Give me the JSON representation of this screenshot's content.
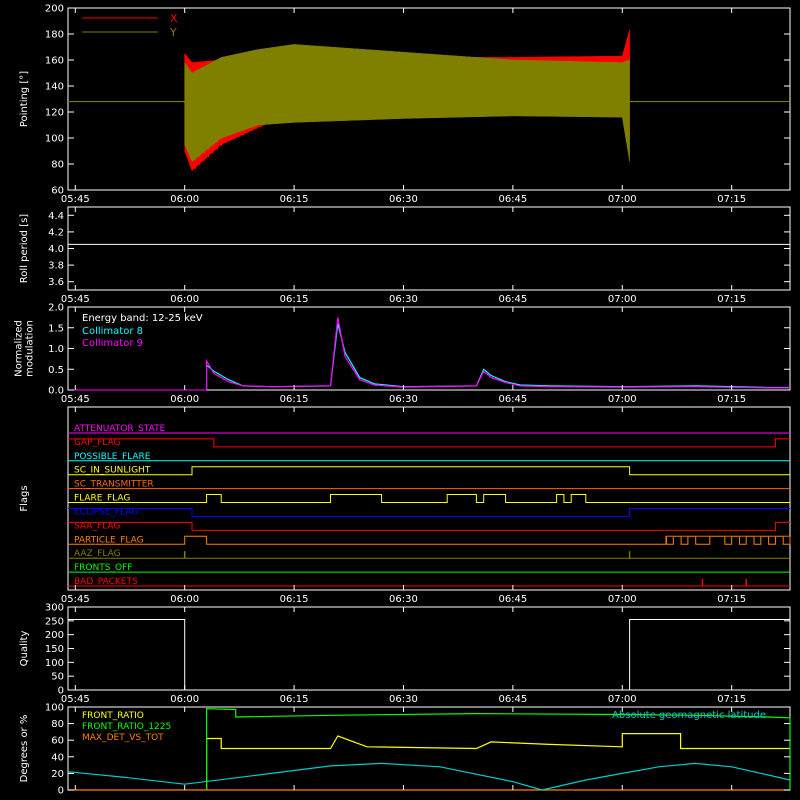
{
  "chart_data": [
    {
      "type": "line",
      "panel": "pointing",
      "ylabel": "Pointing [°]",
      "ylim": [
        60,
        200
      ],
      "yticks": [
        "60",
        "80",
        "100",
        "120",
        "140",
        "160",
        "180",
        "200"
      ],
      "xticks": [
        "05:45",
        "06:00",
        "06:15",
        "06:30",
        "06:45",
        "07:00",
        "07:15"
      ],
      "series": [
        {
          "name": "X",
          "color": "#ff0000",
          "x": [
            "05:44",
            "06:00",
            "06:00",
            "06:01",
            "06:05",
            "06:10",
            "06:15",
            "06:20",
            "06:30",
            "06:45",
            "07:00",
            "07:01",
            "07:01",
            "07:23"
          ],
          "upper": [
            128,
            128,
            165,
            158,
            160,
            162,
            164,
            163,
            162,
            162,
            163,
            183,
            128,
            128
          ],
          "lower": [
            128,
            128,
            90,
            75,
            95,
            108,
            120,
            122,
            123,
            123,
            122,
            100,
            128,
            128
          ]
        },
        {
          "name": "Y",
          "color": "#808000",
          "x": [
            "05:44",
            "06:00",
            "06:00",
            "06:01",
            "06:05",
            "06:10",
            "06:15",
            "06:20",
            "06:30",
            "06:45",
            "07:00",
            "07:01",
            "07:01",
            "07:23"
          ],
          "upper": [
            128,
            128,
            158,
            150,
            162,
            168,
            172,
            170,
            166,
            160,
            158,
            160,
            128,
            128
          ],
          "lower": [
            128,
            128,
            95,
            82,
            100,
            110,
            112,
            113,
            115,
            117,
            116,
            82,
            128,
            128
          ]
        }
      ]
    },
    {
      "type": "line",
      "panel": "roll",
      "ylabel": "Roll period [s]",
      "ylim": [
        3.5,
        4.5
      ],
      "yticks": [
        "3.6",
        "3.8",
        "4.0",
        "4.2",
        "4.4"
      ],
      "xticks": [
        "05:45",
        "06:00",
        "06:15",
        "06:30",
        "06:45",
        "07:00",
        "07:15"
      ],
      "series": [
        {
          "name": "",
          "color": "#ffffff",
          "x": [
            "05:44",
            "07:23"
          ],
          "values": [
            4.05,
            4.05
          ]
        }
      ]
    },
    {
      "type": "line",
      "panel": "modulation",
      "ylabel": [
        "Normalized",
        "modulation"
      ],
      "ylim": [
        0,
        2.0
      ],
      "yticks": [
        "0.0",
        "0.5",
        "1.0",
        "1.5",
        "2.0"
      ],
      "xticks": [
        "05:45",
        "06:00",
        "06:15",
        "06:30",
        "06:45",
        "07:00",
        "07:15"
      ],
      "annotation": "Energy band: 12-25 keV",
      "series": [
        {
          "name": "Collimator 8",
          "color": "#00ffff",
          "x": [
            "06:03",
            "06:03",
            "06:04",
            "06:06",
            "06:08",
            "06:12",
            "06:20",
            "06:21",
            "06:22",
            "06:24",
            "06:26",
            "06:30",
            "06:40",
            "06:41",
            "06:42",
            "06:44",
            "06:46",
            "06:50",
            "07:00",
            "07:10",
            "07:20",
            "07:23"
          ],
          "values": [
            0.0,
            0.6,
            0.45,
            0.25,
            0.1,
            0.08,
            0.1,
            1.6,
            0.9,
            0.3,
            0.15,
            0.08,
            0.1,
            0.5,
            0.35,
            0.2,
            0.12,
            0.1,
            0.08,
            0.1,
            0.06,
            0.06
          ]
        },
        {
          "name": "Collimator 9",
          "color": "#ff00ff",
          "x": [
            "06:03",
            "06:03",
            "06:04",
            "06:06",
            "06:08",
            "06:12",
            "06:20",
            "06:21",
            "06:22",
            "06:24",
            "06:26",
            "06:30",
            "06:40",
            "06:41",
            "06:42",
            "06:44",
            "06:46",
            "06:50",
            "07:00",
            "07:10",
            "07:20",
            "07:23"
          ],
          "values": [
            0.0,
            0.7,
            0.4,
            0.2,
            0.1,
            0.08,
            0.1,
            1.75,
            0.8,
            0.25,
            0.12,
            0.07,
            0.1,
            0.45,
            0.3,
            0.18,
            0.1,
            0.08,
            0.07,
            0.08,
            0.05,
            0.05
          ]
        }
      ]
    },
    {
      "type": "step",
      "panel": "flags",
      "ylabel": "Flags",
      "xticks": [
        "05:45",
        "06:00",
        "06:15",
        "06:30",
        "06:45",
        "07:00",
        "07:15"
      ],
      "flags": [
        {
          "name": "ATTENUATOR_STATE",
          "color": "#ff00ff",
          "x": [
            "05:44",
            "07:23"
          ],
          "v": [
            0,
            0
          ]
        },
        {
          "name": "GAP_FLAG",
          "color": "#ff0000",
          "x": [
            "05:44",
            "06:04",
            "06:04",
            "07:21",
            "07:21",
            "07:23"
          ],
          "v": [
            1,
            1,
            0,
            0,
            1,
            1
          ]
        },
        {
          "name": "POSSIBLE_FLARE",
          "color": "#00ffff",
          "x": [
            "05:44",
            "07:23"
          ],
          "v": [
            0,
            0
          ]
        },
        {
          "name": "SC_IN_SUNLIGHT",
          "color": "#ffff00",
          "x": [
            "05:44",
            "06:01",
            "06:01",
            "07:01",
            "07:01",
            "07:23"
          ],
          "v": [
            0,
            0,
            1,
            1,
            0,
            0
          ]
        },
        {
          "name": "SC_TRANSMITTER",
          "color": "#ff6600",
          "x": [
            "05:44",
            "07:23"
          ],
          "v": [
            0,
            0
          ]
        },
        {
          "name": "FLARE_FLAG",
          "color": "#ffff00",
          "x": [
            "05:44",
            "06:03",
            "06:03",
            "06:05",
            "06:05",
            "06:20",
            "06:20",
            "06:27",
            "06:27",
            "06:36",
            "06:36",
            "06:40",
            "06:40",
            "06:41",
            "06:41",
            "06:44",
            "06:44",
            "06:51",
            "06:51",
            "06:52",
            "06:52",
            "06:53",
            "06:53",
            "06:55",
            "06:55",
            "07:23"
          ],
          "v": [
            0,
            0,
            1,
            1,
            0,
            0,
            1,
            1,
            0,
            0,
            1,
            1,
            0,
            0,
            1,
            1,
            0,
            0,
            1,
            1,
            0,
            0,
            1,
            1,
            0,
            0
          ]
        },
        {
          "name": "ECLIPSE_FLAG",
          "color": "#0000ff",
          "x": [
            "05:44",
            "06:01",
            "06:01",
            "07:01",
            "07:01",
            "07:23"
          ],
          "v": [
            1,
            1,
            0,
            0,
            1,
            1
          ]
        },
        {
          "name": "SAA_FLAG",
          "color": "#ff0000",
          "x": [
            "05:44",
            "06:01",
            "06:01",
            "07:21",
            "07:21",
            "07:23"
          ],
          "v": [
            1,
            1,
            0,
            0,
            1,
            1
          ]
        },
        {
          "name": "PARTICLE_FLAG",
          "color": "#ff8000",
          "x": [
            "05:44",
            "06:00",
            "06:00",
            "06:03",
            "06:03",
            "07:06",
            "07:06",
            "07:23"
          ],
          "v": [
            0,
            0,
            1,
            1,
            0,
            0,
            1,
            1
          ],
          "drops": [
            [
              "07:06",
              "07:07"
            ],
            [
              "07:08",
              "07:09"
            ],
            [
              "07:10",
              "07:12"
            ],
            [
              "07:14",
              "07:15"
            ],
            [
              "07:16",
              "07:17"
            ],
            [
              "07:18",
              "07:19"
            ],
            [
              "07:20",
              "07:21"
            ],
            [
              "07:22",
              "07:23"
            ]
          ]
        },
        {
          "name": "AAZ_FLAG",
          "color": "#808000",
          "x": [
            "05:44",
            "07:23"
          ],
          "v": [
            0,
            0
          ],
          "spikes": [
            "06:00",
            "07:01"
          ]
        },
        {
          "name": "FRONTS_OFF",
          "color": "#00ff00",
          "x": [
            "05:44",
            "07:23"
          ],
          "v": [
            0,
            0
          ]
        },
        {
          "name": "BAD_PACKETS",
          "color": "#ff0000",
          "x": [
            "05:44",
            "07:23"
          ],
          "v": [
            0,
            0
          ],
          "spikes": [
            "07:11",
            "07:17"
          ]
        }
      ]
    },
    {
      "type": "line",
      "panel": "quality",
      "ylabel": "Quality",
      "ylim": [
        0,
        300
      ],
      "yticks": [
        "0",
        "50",
        "100",
        "150",
        "200",
        "250",
        "300"
      ],
      "xticks": [
        "05:45",
        "06:00",
        "06:15",
        "06:30",
        "06:45",
        "07:00",
        "07:15"
      ],
      "series": [
        {
          "name": "",
          "color": "#ffffff",
          "x": [
            "05:44",
            "06:00",
            "06:00",
            "07:01",
            "07:01",
            "07:23"
          ],
          "values": [
            255,
            255,
            0,
            0,
            255,
            255
          ]
        }
      ]
    },
    {
      "type": "line",
      "panel": "ratios",
      "ylabel": "Degrees or %",
      "ylim": [
        0,
        100
      ],
      "yticks": [
        "0",
        "20",
        "40",
        "60",
        "80",
        "100"
      ],
      "xticks": [
        "05:45",
        "06:00",
        "06:15",
        "06:30",
        "06:45",
        "07:00",
        "07:15"
      ],
      "annotation": "Absolute geomagnetic latitude",
      "series": [
        {
          "name": "FRONT_RATIO",
          "color": "#ffff00",
          "x": [
            "06:03",
            "06:03",
            "06:05",
            "06:05",
            "06:20",
            "06:21",
            "06:25",
            "06:40",
            "06:42",
            "06:50",
            "07:00",
            "07:00",
            "07:08",
            "07:08",
            "07:23"
          ],
          "values": [
            0,
            62,
            62,
            50,
            50,
            65,
            52,
            50,
            58,
            55,
            52,
            68,
            68,
            50,
            50
          ]
        },
        {
          "name": "FRONT_RATIO_1225",
          "color": "#00ff00",
          "x": [
            "06:03",
            "06:03",
            "06:07",
            "06:07",
            "06:20",
            "06:40",
            "07:00",
            "07:10",
            "07:20",
            "07:23",
            "07:23"
          ],
          "values": [
            0,
            98,
            97,
            88,
            90,
            92,
            91,
            90,
            88,
            87,
            0
          ]
        },
        {
          "name": "MAX_DET_VS_TOT",
          "color": "#ff8000",
          "x": [
            "05:44",
            "07:23"
          ],
          "values": [
            0,
            0
          ]
        },
        {
          "name": "",
          "color": "#00cccc",
          "x": [
            "05:44",
            "05:52",
            "06:00",
            "06:10",
            "06:20",
            "06:27",
            "06:35",
            "06:45",
            "06:49",
            "06:55",
            "07:05",
            "07:10",
            "07:15",
            "07:23"
          ],
          "values": [
            22,
            15,
            7,
            18,
            29,
            32,
            28,
            10,
            0,
            12,
            28,
            32,
            28,
            12
          ]
        }
      ]
    }
  ]
}
